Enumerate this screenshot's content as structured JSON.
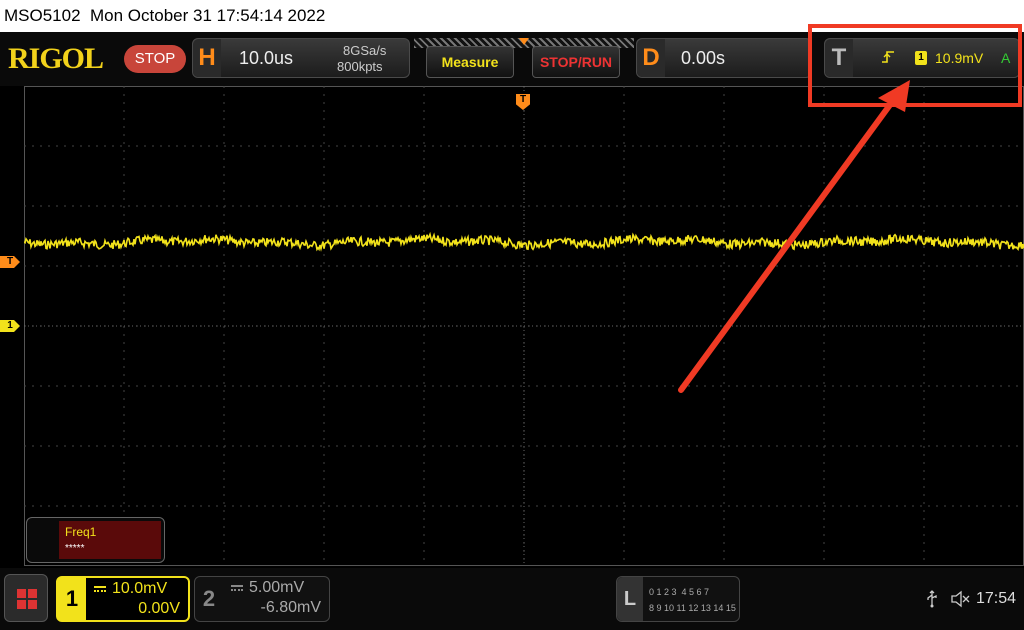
{
  "titlebar": {
    "model": "MSO5102",
    "datetime": "Mon October 31 17:54:14 2022"
  },
  "toolbar": {
    "brand": "RIGOL",
    "run_state": "STOP",
    "horizontal": {
      "letter": "H",
      "timebase": "10.0us",
      "sample_rate": "8GSa/s",
      "memory_depth": "800kpts"
    },
    "measure_label": "Measure",
    "stoprun_label": "STOP/RUN",
    "delay": {
      "letter": "D",
      "value": "0.00s"
    },
    "trigger": {
      "letter": "T",
      "edge_icon": "rising-edge-icon",
      "source": "1",
      "level": "10.9mV",
      "mode": "A"
    }
  },
  "screen": {
    "trigger_position_marker": "T",
    "trigger_level_marker": "T",
    "channel1_marker": "1"
  },
  "measurement": {
    "name": "Freq1",
    "value": "*****"
  },
  "bottom": {
    "ch1": {
      "number": "1",
      "scale": "10.0mV",
      "offset": "0.00V"
    },
    "ch2": {
      "number": "2",
      "scale": "5.00mV",
      "offset": "-6.80mV"
    },
    "la": {
      "letter": "L",
      "row1": "0 1 2 3  4 5 6 7",
      "row2": "8 9 10 11 12 13 14 15"
    },
    "usb_icon": "usb-icon",
    "sound_icon": "speaker-muted-icon",
    "clock": "17:54"
  },
  "colors": {
    "channel1": "#f2e21b",
    "trigger": "#ff8c1a",
    "stop": "#c8453a",
    "annotation": "#f03a24"
  }
}
